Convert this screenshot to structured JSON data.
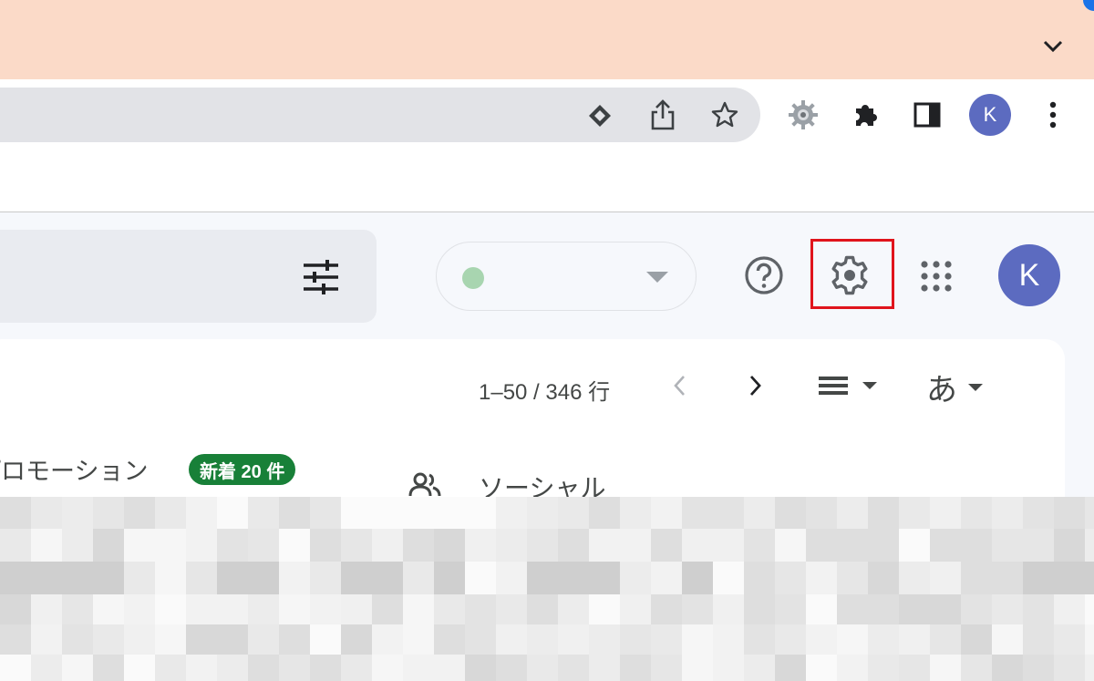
{
  "browser": {
    "avatar_initial": "K",
    "icons": [
      "tab-search-chevron-icon",
      "google-lens-icon",
      "share-icon",
      "bookmark-star-icon",
      "extension-gear-icon",
      "puzzle-extensions-icon",
      "side-panel-icon",
      "chrome-menu-icon"
    ]
  },
  "header": {
    "avatar_initial": "K",
    "status_color": "#a8d5b0",
    "highlight_color": "#e0141c"
  },
  "toolbar": {
    "pagination": "1–50 / 346 行",
    "input_tool_label": "あ"
  },
  "tabs": {
    "promotions": "プロモーション",
    "promotions_badge": "新着 20 件",
    "social": "ソーシャル"
  },
  "colors": {
    "tabstrip_bg": "#fbdac8",
    "badge_green": "#188038",
    "avatar_blue": "#5c6bc0"
  }
}
